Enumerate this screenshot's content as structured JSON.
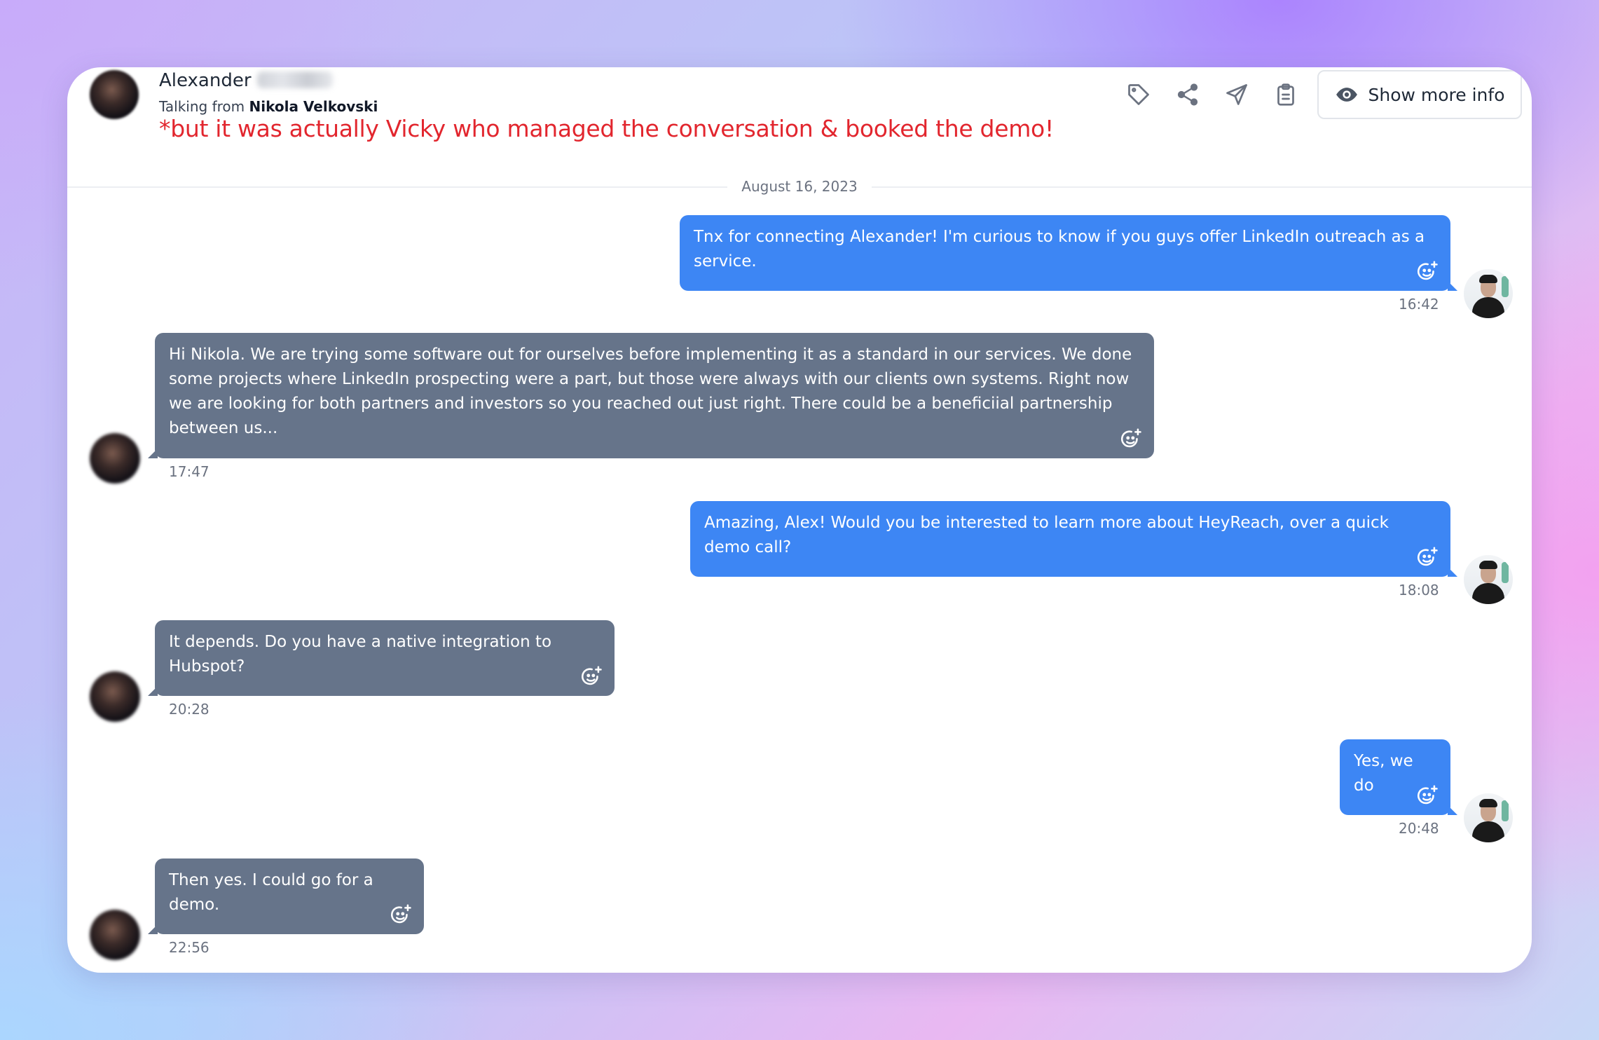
{
  "header": {
    "contact_first_name": "Alexander",
    "talking_from_prefix": "Talking from",
    "talking_from_name": "Nikola Velkovski",
    "annotation": "*but it was actually Vicky who managed the conversation & booked the demo!",
    "annotation_color": "#e2262e",
    "actions": [
      "tag-icon",
      "share-icon",
      "send-icon",
      "clipboard-icon"
    ],
    "show_more_info": "Show more info"
  },
  "conversation": {
    "date": "August 16, 2023",
    "outgoing_color": "#3d86f4",
    "incoming_color": "#66748a",
    "messages": [
      {
        "direction": "outgoing",
        "text": "Tnx for connecting Alexander! I'm curious to know if you guys offer LinkedIn outreach as a service.",
        "time": "16:42"
      },
      {
        "direction": "incoming",
        "text": "Hi Nikola. We are trying some software out for ourselves before implementing it as a standard in our services. We done some projects where LinkedIn prospecting were a part, but those were always with our clients own systems. Right now we are looking for both partners and investors so you reached out just right. There could be a beneficiial partnership between us...",
        "time": "17:47"
      },
      {
        "direction": "outgoing",
        "text": "Amazing, Alex! Would you be interested to learn more about HeyReach, over a quick demo call?",
        "time": "18:08"
      },
      {
        "direction": "incoming",
        "text": "It depends. Do you have a native integration to Hubspot?",
        "time": "20:28"
      },
      {
        "direction": "outgoing",
        "text": "Yes, we do",
        "time": "20:48"
      },
      {
        "direction": "incoming",
        "text": "Then yes. I could go for a demo.",
        "time": "22:56"
      }
    ]
  }
}
